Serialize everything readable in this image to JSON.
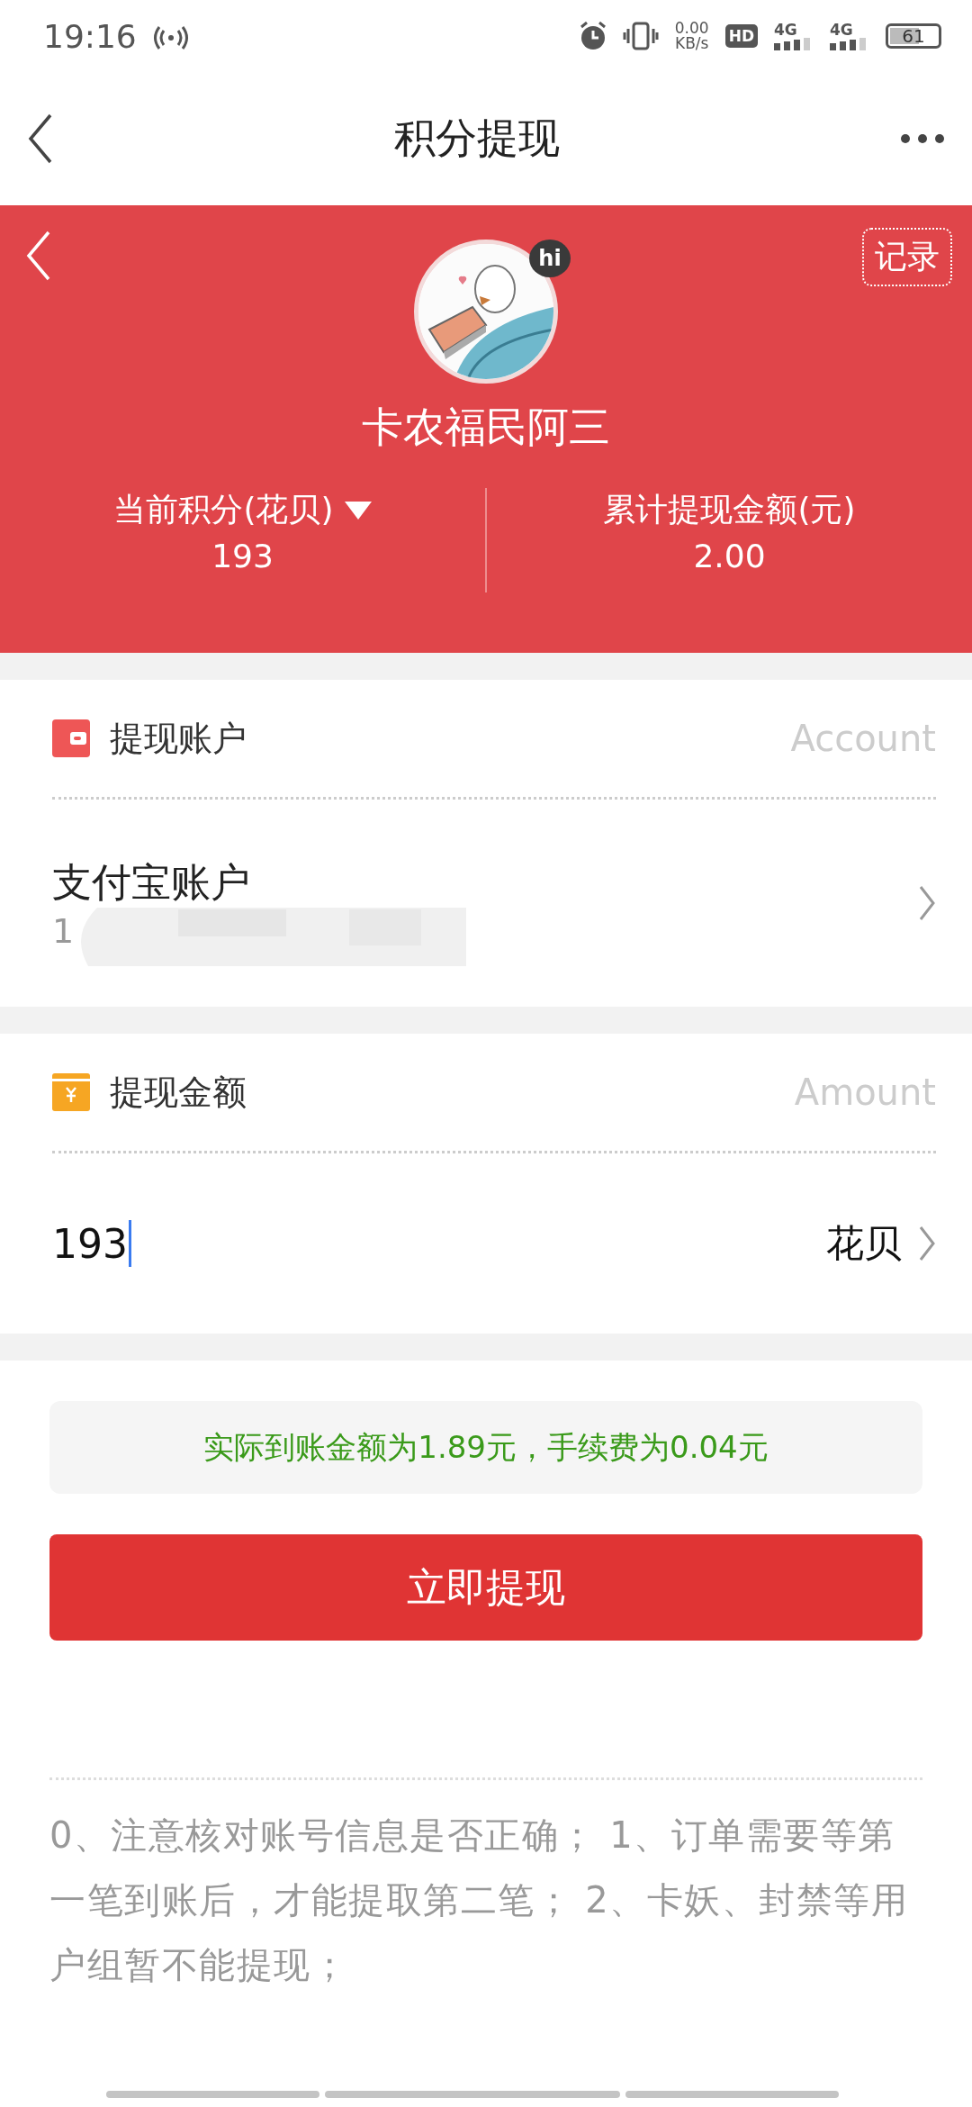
{
  "status_bar": {
    "time": "19:16",
    "net_speed": "0.00",
    "net_unit": "KB/s",
    "hd": "HD",
    "networks": [
      "4G",
      "4G"
    ],
    "battery": "61"
  },
  "nav": {
    "title": "积分提现"
  },
  "profile": {
    "records": "记录",
    "badge": "hi",
    "name": "卡农福民阿三",
    "stats": [
      {
        "label": "当前积分(花贝)",
        "value": "193",
        "dropdown": true
      },
      {
        "label": "累计提现金额(元)",
        "value": "2.00",
        "dropdown": false
      }
    ]
  },
  "account": {
    "title": "提现账户",
    "hint": "Account",
    "name": "支付宝账户",
    "number": "1"
  },
  "amount": {
    "title": "提现金额",
    "hint": "Amount",
    "value": "193",
    "focused": true,
    "unit": "花贝"
  },
  "notice": "实际到账金额为1.89元，手续费为0.04元",
  "submit": "立即提现",
  "rules": "0、注意核对账号信息是否正确； 1、订单需要等第一笔到账后，才能提取第二笔； 2、卡妖、封禁等用户组暂不能提现；"
}
